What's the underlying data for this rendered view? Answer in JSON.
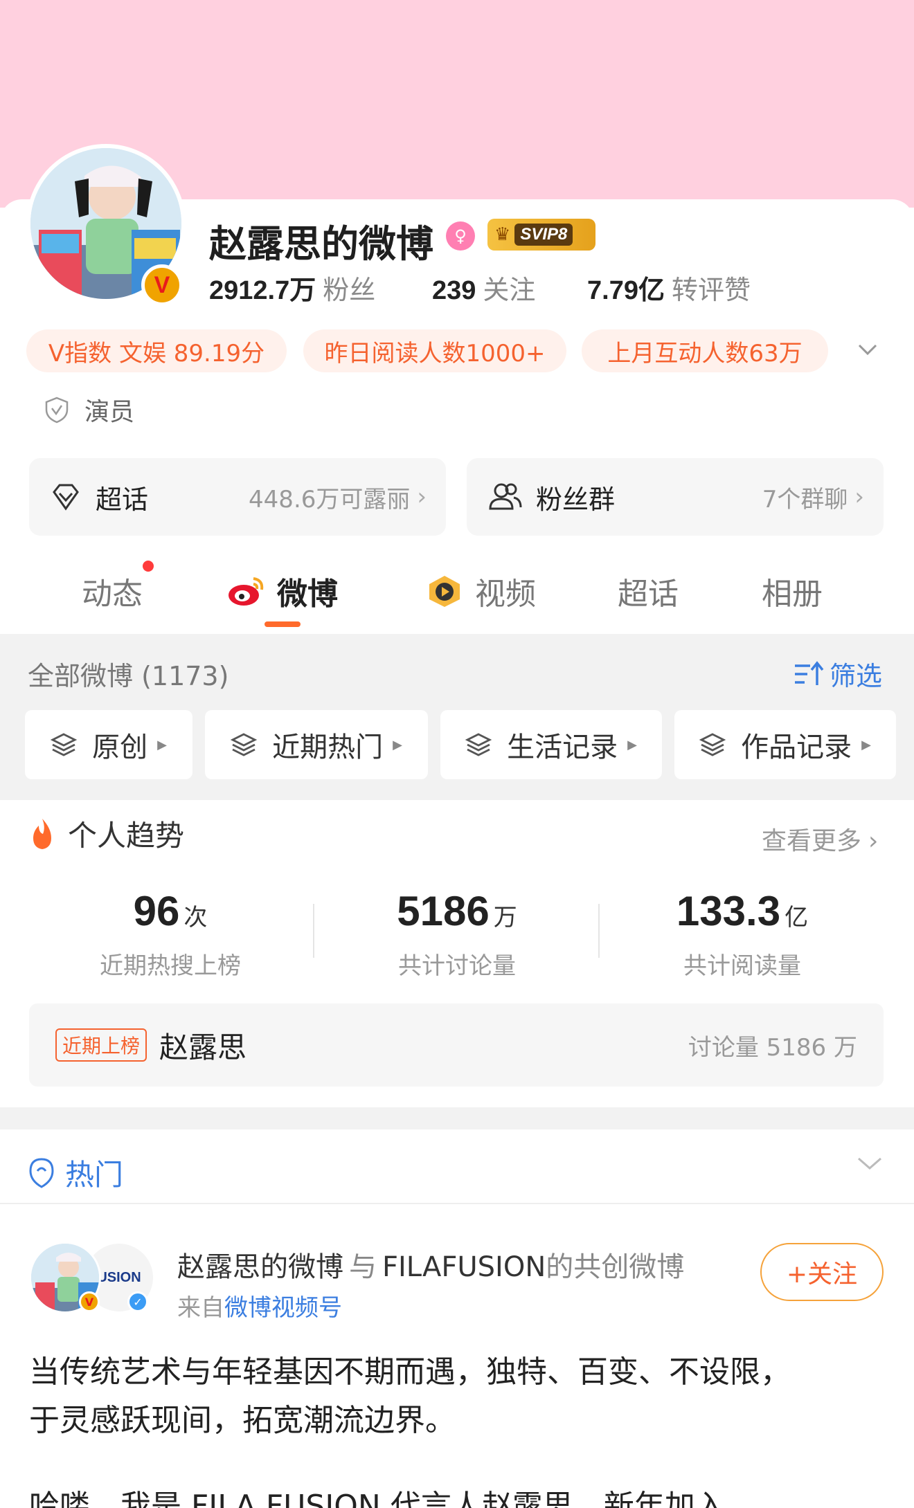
{
  "profile": {
    "name": "赵露思的微博",
    "vip_label": "SVIP8",
    "stats": [
      {
        "value": "2912.7万",
        "label": "粉丝"
      },
      {
        "value": "239",
        "label": "关注"
      },
      {
        "value": "7.79亿",
        "label": "转评赞"
      }
    ],
    "pills": [
      "V指数 文娱 89.19分",
      "昨日阅读人数1000+",
      "上月互动人数63万"
    ],
    "role": "演员"
  },
  "boxes": {
    "supertopic": {
      "label": "超话",
      "value": "448.6万可露丽"
    },
    "fangroup": {
      "label": "粉丝群",
      "value": "7个群聊"
    }
  },
  "tabs": [
    "动态",
    "微博",
    "视频",
    "超话",
    "相册"
  ],
  "feed": {
    "all_count": "全部微博 (1173)",
    "filter": "筛选",
    "chips": [
      "原创",
      "近期热门",
      "生活记录",
      "作品记录"
    ]
  },
  "trend": {
    "title": "个人趋势",
    "more": "查看更多",
    "metrics": [
      {
        "value": "96",
        "unit": "次",
        "label": "近期热搜上榜"
      },
      {
        "value": "5186",
        "unit": "万",
        "label": "共计讨论量"
      },
      {
        "value": "133.3",
        "unit": "亿",
        "label": "共计阅读量"
      }
    ],
    "hot": {
      "tag": "近期上榜",
      "name": "赵露思",
      "discussion": "讨论量 5186 万"
    }
  },
  "hot_section": {
    "title": "热门"
  },
  "post": {
    "author": "赵露思的微博",
    "with": "与",
    "coauthor": "FILAFUSION",
    "suffix": "的共创微博",
    "source_prefix": "来自",
    "source": "微博视频号",
    "follow": "+关注",
    "coauthor_avatar_text": "USION",
    "body_line1": "当传统艺术与年轻基因不期而遇，独特、百变、不设限，",
    "body_line2": "于灵感跃现间，拓宽潮流边界。",
    "body_line3": "哈喽，我是 FILA FUSION 代言人赵露思，新年加入"
  }
}
